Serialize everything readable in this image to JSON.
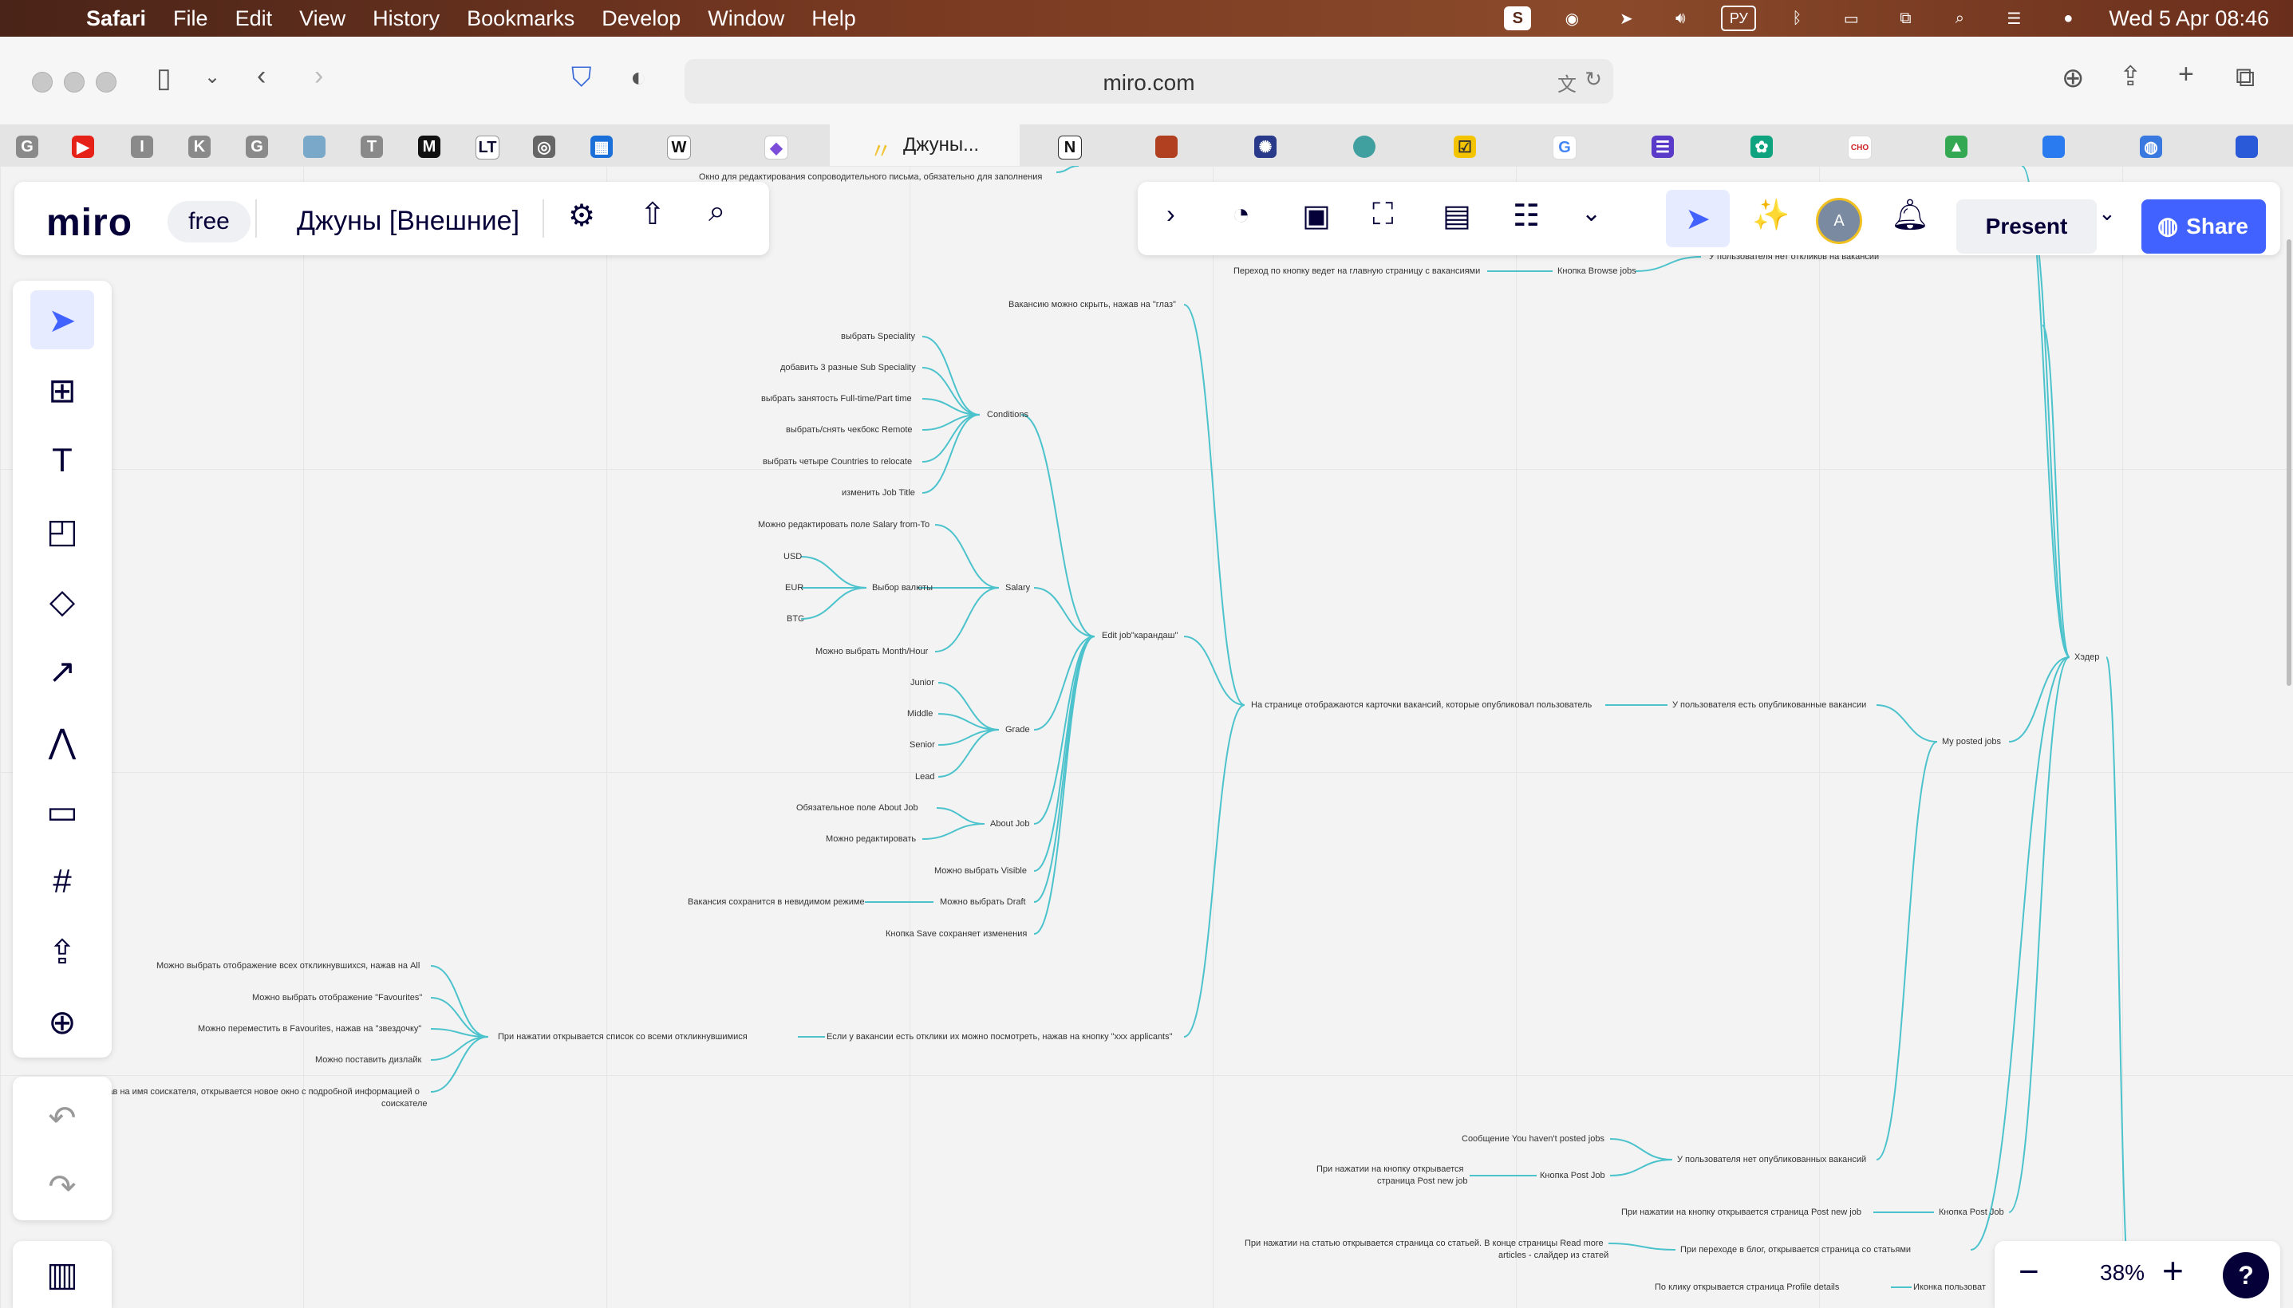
{
  "menubar": {
    "app": "Safari",
    "items": [
      "File",
      "Edit",
      "View",
      "History",
      "Bookmarks",
      "Develop",
      "Window",
      "Help"
    ],
    "input_source": "РУ",
    "datetime": "Wed 5 Apr  08:46"
  },
  "browser": {
    "url": "miro.com",
    "active_tab": "Джуны...",
    "favicons": [
      "G",
      "I",
      "K",
      "G",
      "T",
      "W",
      "N"
    ]
  },
  "miro": {
    "logo": "miro",
    "plan": "free",
    "board_name": "Джуны [Внешние]",
    "present_label": "Present",
    "share_label": "Share",
    "avatar": "A",
    "zoom": "38%",
    "help": "?"
  },
  "mindmap": {
    "top_partial": "Окно для редактирования сопроводительного письма, обязательно для заполнения",
    "browse_jobs_text": "Переход по кнопку ведет на главную страницу с вакансиями",
    "browse_jobs": "Кнопка Browse jobs",
    "no_responses": "У пользователя нет откликов на вакансии",
    "hide_eye": "Вакансию можно скрыть, нажав на \"глаз\"",
    "conditions": "Conditions",
    "cond_items": [
      "выбрать Speciality",
      "добавить 3 разные Sub Speciality",
      "выбрать занятость Full-time/Part time",
      "выбрать/снять чекбокс Remote",
      "выбрать четыре Countries to relocate",
      "изменить Job Title"
    ],
    "salary": "Salary",
    "salary_edit": "Можно редактировать поле Salary from-To",
    "currency": "Выбор валюты",
    "currencies": [
      "USD",
      "EUR",
      "BTC"
    ],
    "month_hour": "Можно выбрать Month/Hour",
    "edit_job": "Edit job\"карандаш\"",
    "grade": "Grade",
    "grades": [
      "Junior",
      "Middle",
      "Senior",
      "Lead"
    ],
    "about_job": "About Job",
    "about_items": [
      "Обязательное поле About Job",
      "Можно редактировать"
    ],
    "visible": "Можно выбрать Visible",
    "draft": "Можно выбрать Draft",
    "draft_note": "Вакансия сохранится в невидимом режиме",
    "save_btn": "Кнопка Save сохраняет изменения",
    "cards": "На странице отображаются карточки вакансий, которые опубликовал пользователь",
    "has_posted": "У пользователя есть опубликованные вакансии",
    "my_posted": "My posted jobs",
    "header": "Хэдер",
    "applicants": "Если у вакансии есть отклики их можно посмотреть, нажав на кнопку \"xxx applicants\"",
    "applicant_list": "При нажатии открывается список со всеми откликнувшимися",
    "applicant_items": [
      "Можно выбрать отображение всех откликнувшихся, нажав на All",
      "Можно выбрать отображение \"Favourites\"",
      "Можно переместить в Favourites, нажав на \"звездочку\"",
      "Можно  поставить дизлайк"
    ],
    "applicant_name_1": "Нажав на имя соискателя, открывается новое окно с подробной информацией о",
    "applicant_name_2": "соискателе",
    "no_posted_msg": "Сообщение You haven't posted jobs",
    "post_job_open_1": "При нажатии на кнопку открывается",
    "post_job_open_2": "страница Post new job",
    "post_job_btn": "Кнопка  Post Job",
    "no_posted": "У пользователя нет опубликованных вакансий",
    "post_new_job": "При нажатии на кнопку открывается страница Post new job",
    "post_job_btn2": "Кнопка Post Job",
    "article_1": "При нажатии на статью открывается страница со статьей. В конце страницы Read more",
    "article_2": "articles - слайдер из статей",
    "blog": "При переходе в блог, открывается страница со статьями",
    "profile_details": "По клику открывается страница Profile details",
    "profile_icon": "Иконка пользоват"
  }
}
